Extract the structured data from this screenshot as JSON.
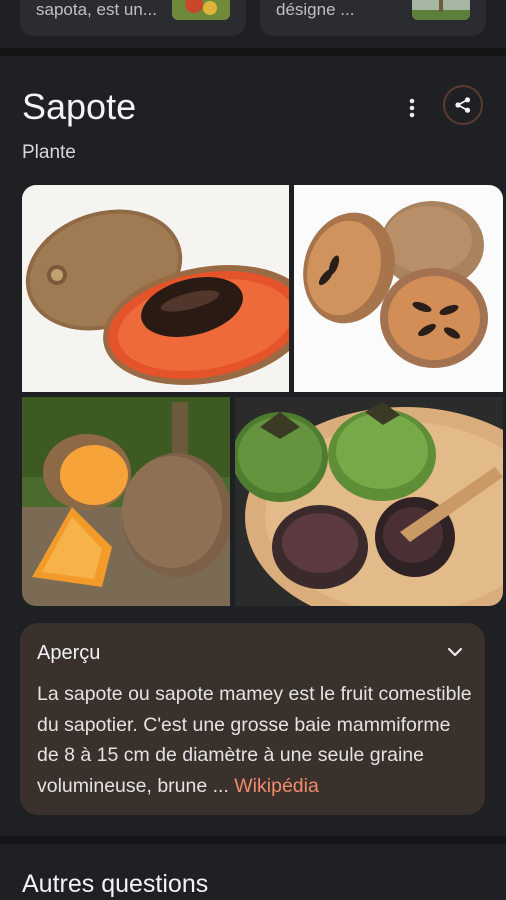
{
  "top_cards": [
    {
      "text": "sapota, est un..."
    },
    {
      "text": "désigne ..."
    }
  ],
  "entity": {
    "title": "Sapote",
    "subtitle": "Plante"
  },
  "icons": {
    "more": "more-vert-icon",
    "share": "share-icon",
    "expand": "chevron-down-icon"
  },
  "overview": {
    "title": "Aperçu",
    "body": "La sapote ou sapote mamey est le fruit comestible du sapotier. C'est une grosse baie mammiforme de 8 à 15 cm de diamètre à une seule graine volumineuse, brune ",
    "ellipsis": "... ",
    "source": "Wikipédia"
  },
  "next_section": {
    "title": "Autres questions"
  },
  "colors": {
    "background": "#1f2023",
    "card": "#3a302c",
    "link": "#f28b6e"
  }
}
